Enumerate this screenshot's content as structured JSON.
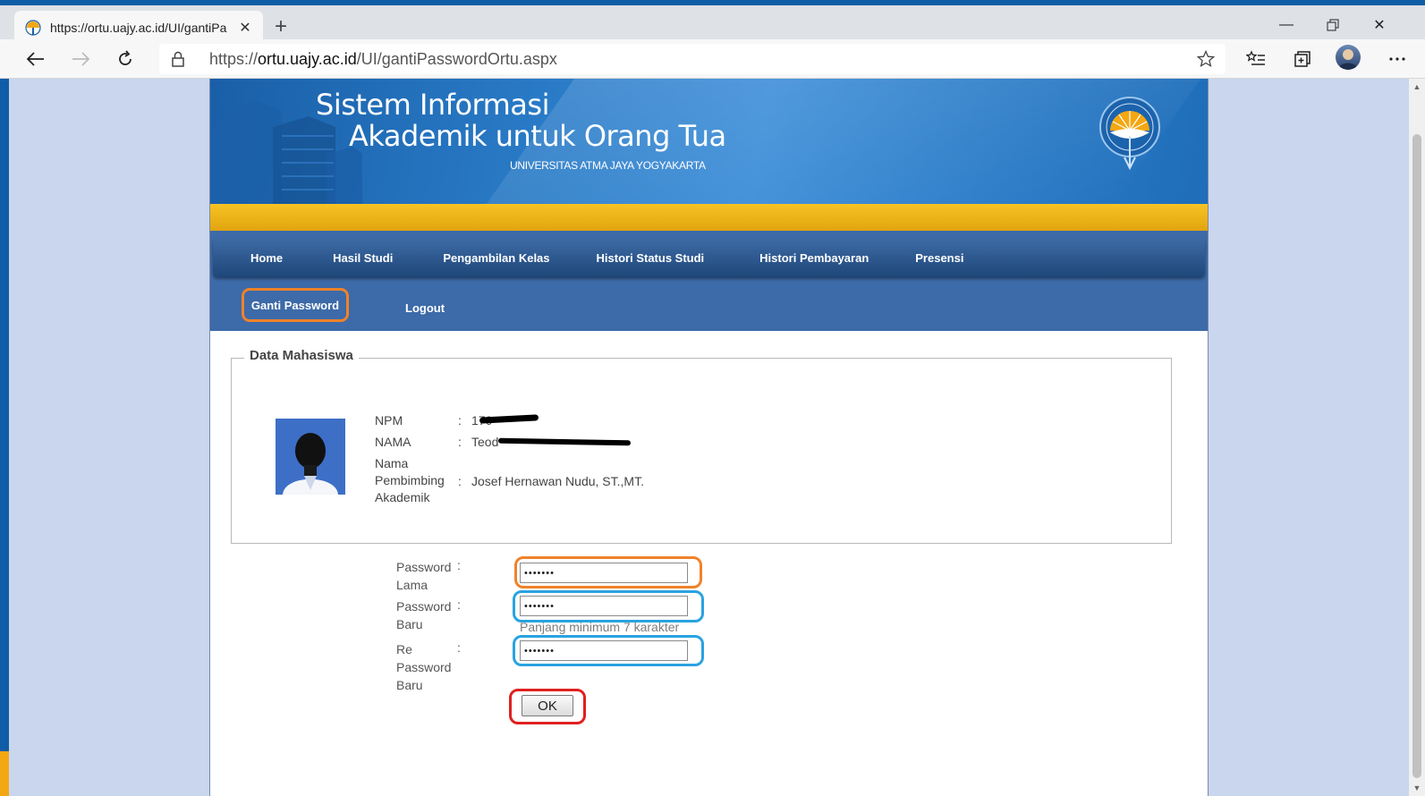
{
  "browser": {
    "tab_title": "https://ortu.uajy.ac.id/UI/gantiPa",
    "url_scheme": "https://",
    "url_host": "ortu.uajy.ac.id",
    "url_path": "/UI/gantiPasswordOrtu.aspx"
  },
  "header": {
    "title_line1": "Sistem Informasi",
    "title_line2": "Akademik untuk Orang Tua",
    "university": "UNIVERSITAS ATMA JAYA YOGYAKARTA"
  },
  "nav": {
    "items": [
      "Home",
      "Hasil Studi",
      "Pengambilan Kelas",
      "Histori Status Studi",
      "Histori Pembayaran",
      "Presensi"
    ],
    "sub_items": [
      "Ganti Password",
      "Logout"
    ]
  },
  "student": {
    "legend": "Data Mahasiswa",
    "npm_label": "NPM",
    "npm_value": "170",
    "nama_label": "NAMA",
    "nama_value": "Teod",
    "pembimbing_label_1": "Nama",
    "pembimbing_label_2": "Pembimbing",
    "pembimbing_label_3": "Akademik",
    "pembimbing_value": "Josef Hernawan Nudu, ST.,MT.",
    "colon": ":"
  },
  "form": {
    "old_label_1": "Password",
    "old_label_2": "Lama",
    "new_label_1": "Password",
    "new_label_2": "Baru",
    "re_label_1": "Re",
    "re_label_2": "Password",
    "re_label_3": "Baru",
    "colon": ":",
    "old_value": "•••••••",
    "new_value": "•••••••",
    "re_value": "•••••••",
    "hint": "Panjang minimum 7 karakter",
    "ok_label": "OK"
  },
  "highlight_colors": {
    "orange": "#f0822a",
    "blue": "#29a3e0",
    "red": "#e02020"
  }
}
